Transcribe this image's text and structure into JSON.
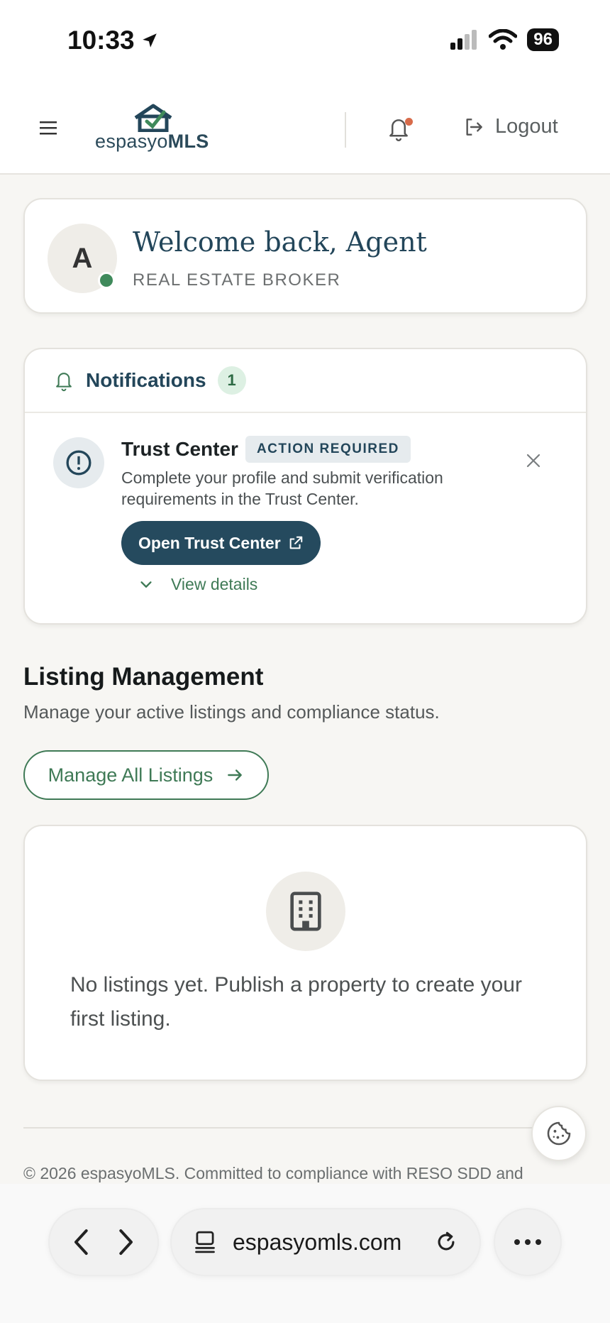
{
  "status_bar": {
    "time": "10:33",
    "battery": "96"
  },
  "header": {
    "logo_text_light": "espasyo",
    "logo_text_bold": "MLS",
    "logout_label": "Logout"
  },
  "welcome": {
    "avatar_initial": "A",
    "title": "Welcome back, Agent",
    "role": "REAL ESTATE BROKER"
  },
  "notifications": {
    "title": "Notifications",
    "count": "1",
    "item": {
      "title": "Trust Center",
      "badge": "ACTION REQUIRED",
      "description": "Complete your profile and submit verification requirements in the Trust Center.",
      "primary_action": "Open Trust Center",
      "details_link": "View details"
    }
  },
  "listing_management": {
    "title": "Listing Management",
    "subtitle": "Manage your active listings and compliance status.",
    "manage_button": "Manage All Listings",
    "empty_text": "No listings yet. Publish a property to create your first listing."
  },
  "footer": {
    "text": "© 2026 espasyoMLS. Committed to compliance with RESO SDD and"
  },
  "browser": {
    "url": "espasyomls.com"
  },
  "colors": {
    "brand_navy": "#254a5e",
    "brand_green": "#3f7a56",
    "online_dot": "#3f8a5b",
    "notification_dot": "#d86b4a"
  }
}
